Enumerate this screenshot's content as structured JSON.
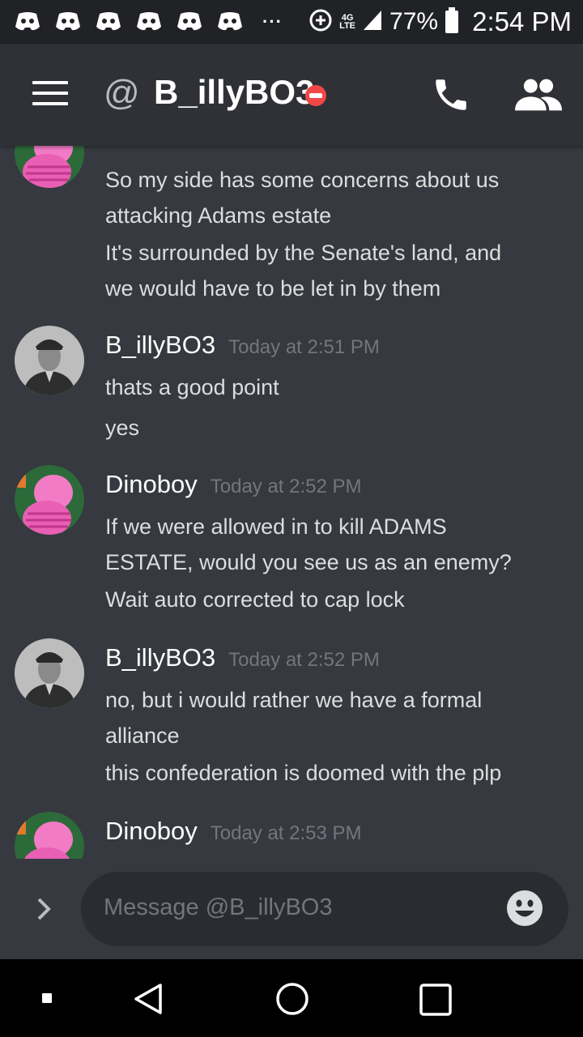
{
  "status_bar": {
    "notification_icons": [
      "discord-icon",
      "discord-icon",
      "discord-icon",
      "discord-icon",
      "discord-icon",
      "discord-icon"
    ],
    "more_indicator": "···",
    "network_type": "4G LTE",
    "battery": "77%",
    "time": "2:54 PM"
  },
  "header": {
    "at_symbol": "@",
    "title": "B_illyBO3",
    "status": "do-not-disturb",
    "status_color": "#f04747"
  },
  "messages": [
    {
      "author": "",
      "timestamp": "",
      "avatar": "pink-pig-avatar",
      "lines": [
        "So my side has some concerns about us",
        "attacking Adams estate",
        "It's surrounded by the Senate's land, and",
        "we would have to be let in by them"
      ]
    },
    {
      "author": "B_illyBO3",
      "timestamp": "Today at 2:51 PM",
      "avatar": "officer-portrait-avatar",
      "lines": [
        "thats a good point",
        "yes"
      ]
    },
    {
      "author": "Dinoboy",
      "timestamp": "Today at 2:52 PM",
      "avatar": "pink-pig-avatar",
      "lines": [
        "If we were allowed in to kill ADAMS",
        "ESTATE, would you see us as an enemy?",
        "Wait auto corrected to cap lock"
      ]
    },
    {
      "author": "B_illyBO3",
      "timestamp": "Today at 2:52 PM",
      "avatar": "officer-portrait-avatar",
      "lines": [
        "no, but i would rather we have a formal",
        "alliance",
        "this confederation is doomed with the plp"
      ]
    },
    {
      "author": "Dinoboy",
      "timestamp": "Today at 2:53 PM",
      "avatar": "pink-pig-avatar",
      "lines": []
    }
  ],
  "input": {
    "placeholder": "Message @B_illyBO3"
  },
  "colors": {
    "background": "#36393f",
    "header": "#2f3136",
    "status_bar": "#202225",
    "input": "#2a2c31",
    "dnd": "#f04747"
  }
}
